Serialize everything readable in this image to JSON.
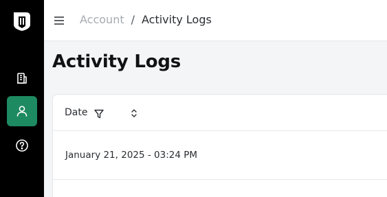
{
  "sidebar": {
    "logo_icon": "shield-d-logo",
    "items": [
      {
        "icon": "building-icon",
        "active": false
      },
      {
        "icon": "user-icon",
        "active": true
      },
      {
        "icon": "help-icon",
        "active": false
      }
    ],
    "active_color": "#1e8a62"
  },
  "header": {
    "menu_icon": "hamburger-icon",
    "breadcrumb": {
      "parent": "Account",
      "separator": "/",
      "current": "Activity Logs"
    }
  },
  "page": {
    "title": "Activity Logs"
  },
  "table": {
    "columns": [
      {
        "label": "Date",
        "filter_icon": "filter-icon",
        "sort_icon": "sort-icon"
      }
    ],
    "rows": [
      {
        "date": "January 21, 2025 - 03:24 PM"
      }
    ]
  }
}
